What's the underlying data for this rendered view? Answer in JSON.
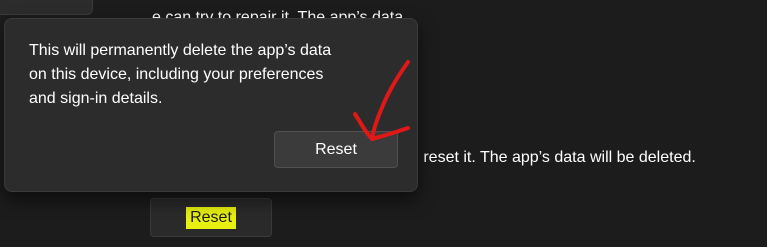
{
  "background": {
    "line1_text": "e can try to repair it. The app’s data",
    "line2_text": "t, reset it. The app’s data will be deleted."
  },
  "flyout": {
    "message": "This will permanently delete the app’s data\non this device, including your preferences\nand sign-in details.",
    "confirm_label": "Reset"
  },
  "reset_button": {
    "label": "Reset",
    "highlight_color": "#e7f00f"
  },
  "annotation": {
    "type": "checkmark-arrow",
    "color": "#e01818"
  }
}
